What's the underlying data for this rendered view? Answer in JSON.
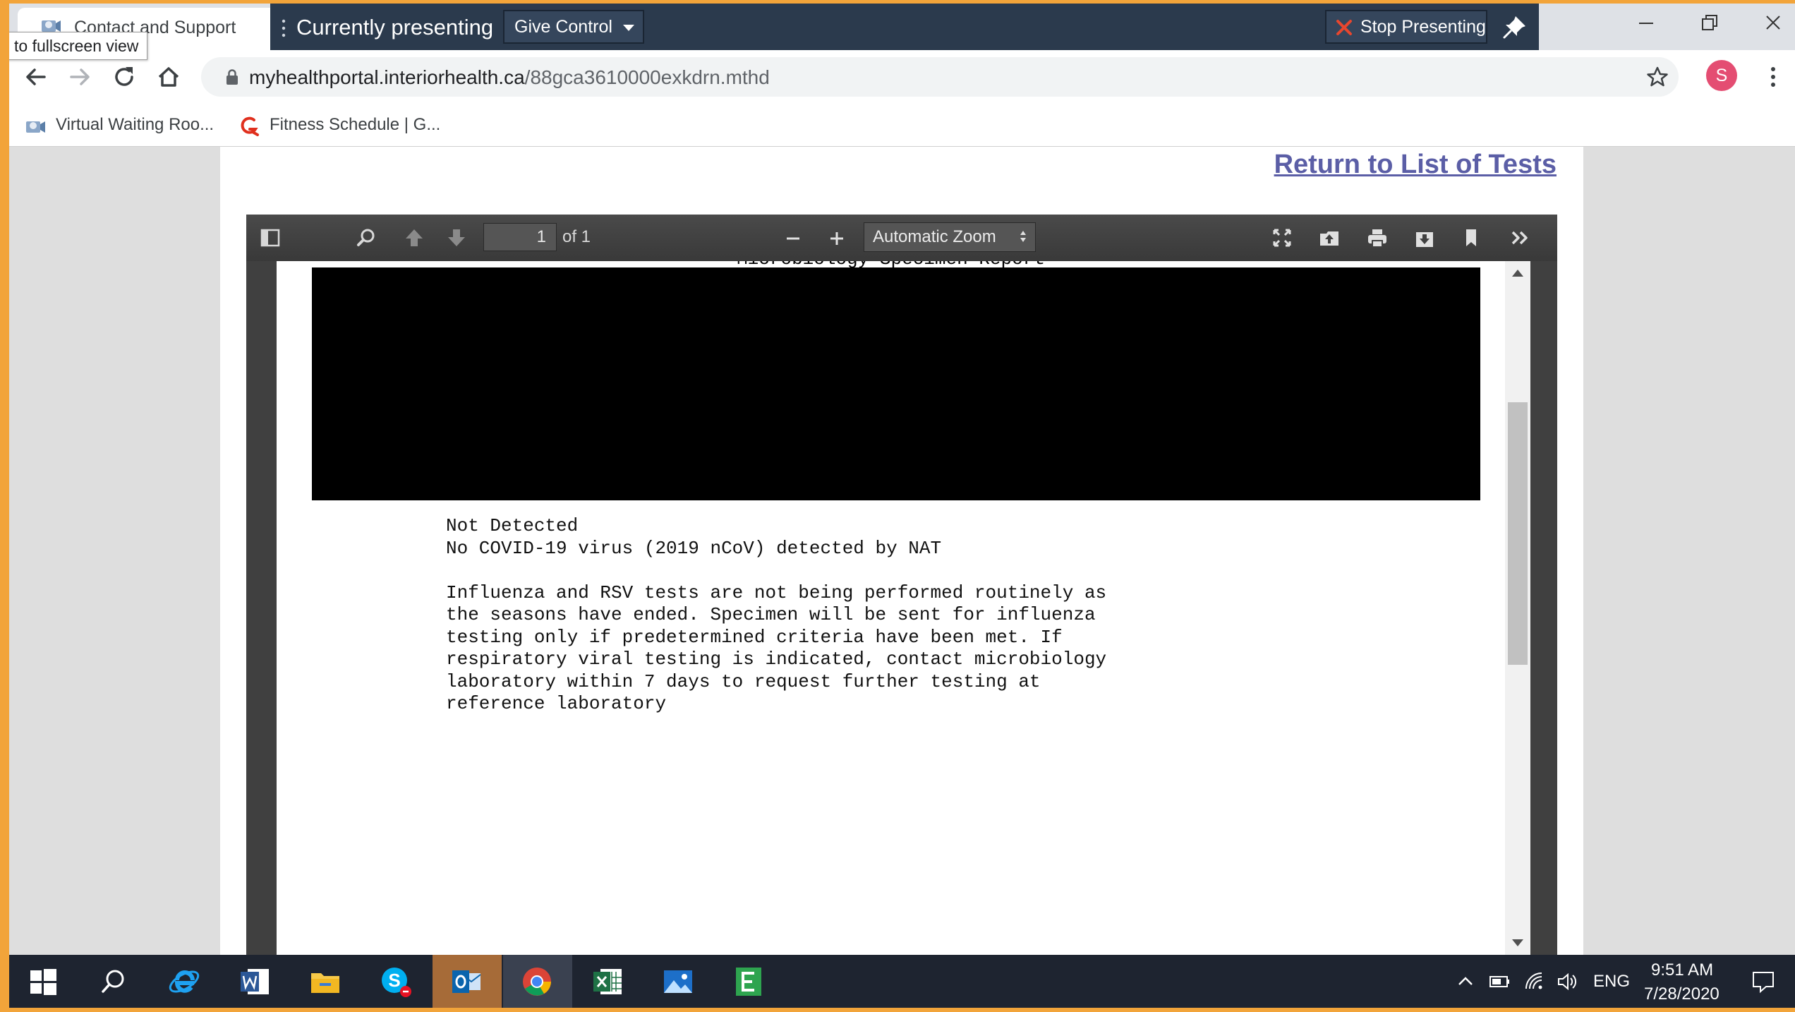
{
  "browser": {
    "tab_title": "Contact and Support",
    "tooltip": "to fullscreen view",
    "url_host": "myhealthportal.interiorhealth.ca",
    "url_path": "/88gca3610000exkdrn.mthd",
    "profile_initial": "S",
    "bookmarks": [
      {
        "label": "Virtual Waiting Roo...",
        "icon": "video-meeting-icon"
      },
      {
        "label": "Fitness Schedule | G...",
        "icon": "fitness-logo-icon"
      }
    ]
  },
  "presenting": {
    "label": "Currently presenting",
    "give_control": "Give Control",
    "stop": "Stop Presenting"
  },
  "page": {
    "return_link": "Return to List of Tests"
  },
  "pdf_viewer": {
    "page_number": "1",
    "page_of": "of 1",
    "zoom": "Automatic Zoom",
    "report_title": "Microbiology Specimen Report",
    "result_lines": "Not Detected\nNo COVID-19 virus (2019 nCoV) detected by NAT\n\nInfluenza and RSV tests are not being performed routinely as\nthe seasons have ended. Specimen will be sent for influenza\ntesting only if predetermined criteria have been met. If\nrespiratory viral testing is indicated, contact microbiology\nlaboratory within 7 days to request further testing at\nreference laboratory"
  },
  "taskbar": {
    "language": "ENG",
    "time": "9:51 AM",
    "date": "7/28/2020"
  },
  "colors": {
    "accent_border": "#f2a43a",
    "presenting_bar": "#2b3a4d",
    "link": "#5b5ea6",
    "stop_x": "#e8462e"
  }
}
